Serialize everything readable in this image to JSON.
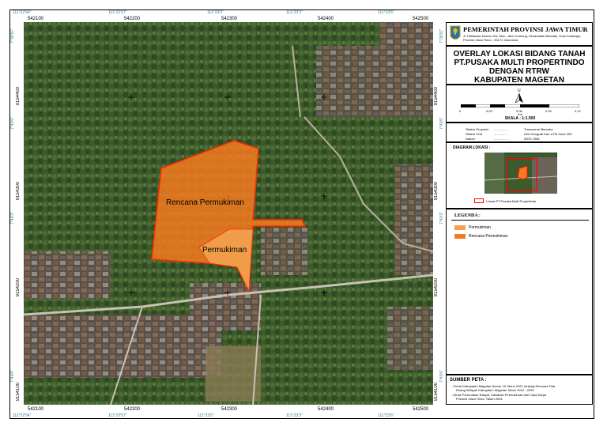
{
  "colors": {
    "permukiman": "#f2a24f",
    "rencana_permukiman": "#f47a1f",
    "boundary": "#ff2a00"
  },
  "grid": {
    "top_easting": [
      "542100",
      "542200",
      "542300",
      "542400",
      "542500"
    ],
    "bottom_easting": [
      "542100",
      "542200",
      "542300",
      "542400",
      "542500"
    ],
    "top_long": [
      "111°22'54\"",
      "111°22'57\"",
      "111°23'0\"",
      "111°23'3\"",
      "111°23'6\""
    ],
    "bottom_long": [
      "111°22'54\"",
      "111°22'57\"",
      "111°23'0\"",
      "111°23'3\"",
      "111°23'6\""
    ],
    "northing": [
      "9154400",
      "9154300",
      "9154200",
      "9154100"
    ],
    "lat": [
      "7°39'57\"",
      "7°40'0\"",
      "7°40'3\"",
      "7°40'6\""
    ]
  },
  "map": {
    "label_rencana": "Rencana Permukiman",
    "label_permukiman": "Permukiman"
  },
  "header": {
    "org": "PEMERINTAH PROVINSI JAWA TIMUR",
    "address_1": "Jl. Pahlawan Nomor 110, Alun - Alun Contong, Kecamatan Bubutan, Kota Surabaya,",
    "address_2": "Provinsi Jawa Timur - 60174 Indonesia"
  },
  "title": {
    "line1": "OVERLAY LOKASI BIDANG TANAH",
    "line2": "PT.PUSAKA MULTI PROPERTINDO",
    "line3": "DENGAN RTRW",
    "line4": "KABUPATEN MAGETAN"
  },
  "north": "U",
  "scale": {
    "ticks": [
      "0",
      "0.03",
      "0.06",
      "0.09",
      "0.12"
    ],
    "unit": "Km",
    "label": "SKALA : 1:1.500"
  },
  "projection": {
    "rows": [
      {
        "k": "Sistem Proyeksi",
        "v": "Transverse Mercator"
      },
      {
        "k": "Sistem Grid",
        "v": "Grid Geografi Dan UTM Zona 49S"
      },
      {
        "k": "Datum",
        "v": "WGS 1984"
      }
    ]
  },
  "location": {
    "title": "DIAGRAM LOKASI :",
    "caption": "Lokasi PT.Pusaka Multi Propertindo"
  },
  "legend": {
    "title": "LEGENDA :",
    "items": [
      {
        "label": "Permukiman"
      },
      {
        "label": "Rencana Permukiman"
      }
    ]
  },
  "sources": {
    "title": "SUMBER PETA :",
    "line1": "- Perda Kabupaten Magetan Nomor 15 Tahun 2021 tentang Rencana Tata",
    "line2": "Ruang Wilayah Kabupaten Magetan Tahun 2012 - 2032",
    "line3": "- Dinas Perumahan Rakyat, Kawasan Permukiman dan Cipta Karya",
    "line4": "Provinsi Jawa Timur, Tahun 2024"
  }
}
